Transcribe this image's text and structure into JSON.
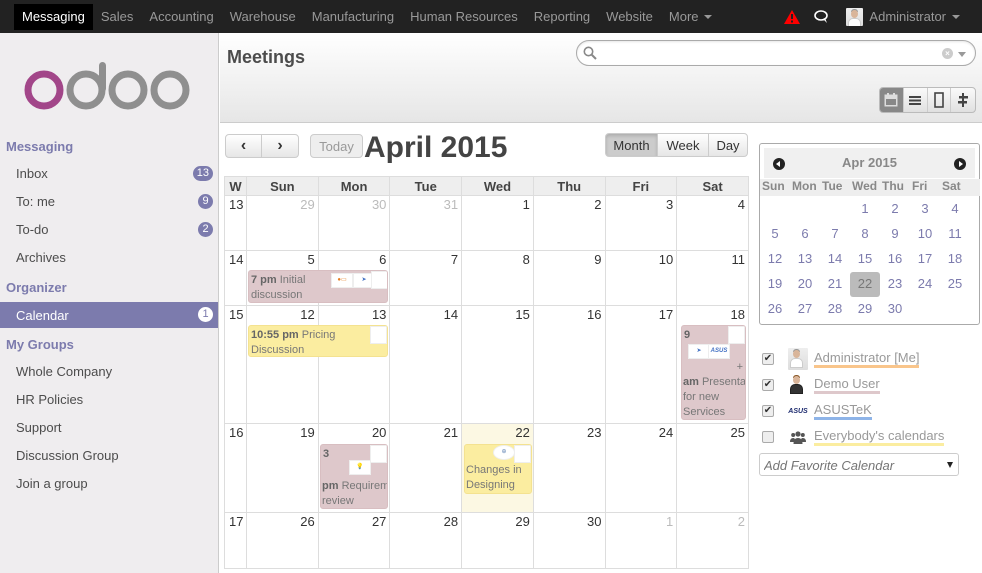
{
  "topbar": {
    "apps": [
      "Messaging",
      "Sales",
      "Accounting",
      "Warehouse",
      "Manufacturing",
      "Human Resources",
      "Reporting",
      "Website",
      "More"
    ],
    "active_app": "Messaging",
    "user_name": "Administrator",
    "icons": [
      "warning-icon",
      "chat-icon"
    ],
    "warning_color": "#ff0000"
  },
  "sidebar": {
    "logo_text": "odoo",
    "sections": [
      {
        "title": "Messaging",
        "items": [
          {
            "label": "Inbox",
            "badge": "13"
          },
          {
            "label": "To: me",
            "badge": "9"
          },
          {
            "label": "To-do",
            "badge": "2"
          },
          {
            "label": "Archives",
            "badge": null
          }
        ]
      },
      {
        "title": "Organizer",
        "items": [
          {
            "label": "Calendar",
            "badge": "1",
            "active": true
          }
        ]
      },
      {
        "title": "My Groups",
        "items": [
          {
            "label": "Whole Company"
          },
          {
            "label": "HR Policies"
          },
          {
            "label": "Support"
          },
          {
            "label": "Discussion Group"
          },
          {
            "label": "Join a group"
          }
        ]
      }
    ],
    "accent_color": "#7c7bad"
  },
  "header": {
    "title": "Meetings",
    "search_placeholder": "",
    "views": [
      "calendar-view",
      "list-view",
      "form-view",
      "gantt-view"
    ],
    "active_view": "calendar-view"
  },
  "calendar": {
    "prev_label": "‹",
    "next_label": "›",
    "today_label": "Today",
    "title": "April 2015",
    "modes": [
      "Month",
      "Week",
      "Day"
    ],
    "active_mode": "Month",
    "headers": [
      "W",
      "Sun",
      "Mon",
      "Tue",
      "Wed",
      "Thu",
      "Fri",
      "Sat"
    ],
    "weeks": [
      {
        "w": "13",
        "days": [
          "29",
          "30",
          "31",
          "1",
          "2",
          "3",
          "4"
        ],
        "other": [
          0,
          1,
          2
        ]
      },
      {
        "w": "14",
        "days": [
          "5",
          "6",
          "7",
          "8",
          "9",
          "10",
          "11"
        ],
        "other": []
      },
      {
        "w": "15",
        "days": [
          "12",
          "13",
          "14",
          "15",
          "16",
          "17",
          "18"
        ],
        "other": []
      },
      {
        "w": "16",
        "days": [
          "19",
          "20",
          "21",
          "22",
          "23",
          "24",
          "25"
        ],
        "other": []
      },
      {
        "w": "17",
        "days": [
          "26",
          "27",
          "28",
          "29",
          "30",
          "1",
          "2"
        ],
        "other": [
          5,
          6
        ]
      }
    ],
    "today": "22",
    "events": [
      {
        "time": "7 pm",
        "title": "Initial discussion",
        "days": "5-6",
        "color": "pink"
      },
      {
        "time": "10:55 pm",
        "title": "Pricing Discussion",
        "days": "12-13",
        "color": "yellow"
      },
      {
        "time_a": "9",
        "time_b": "am",
        "title": "Presentation for new Services",
        "day": "18",
        "color": "pink",
        "more": "+"
      },
      {
        "time_a": "3",
        "time_b": "pm",
        "title": "Requirements review",
        "day": "20",
        "color": "pink"
      },
      {
        "time": "",
        "title": "Changes in Designing",
        "day": "22",
        "color": "yellow"
      }
    ]
  },
  "mini_calendar": {
    "title": "Apr 2015",
    "dow": [
      "Sun",
      "Mon",
      "Tue",
      "Wed",
      "Thu",
      "Fri",
      "Sat"
    ],
    "rows": [
      [
        "",
        "",
        "",
        "1",
        "2",
        "3",
        "4"
      ],
      [
        "5",
        "6",
        "7",
        "8",
        "9",
        "10",
        "11"
      ],
      [
        "12",
        "13",
        "14",
        "15",
        "16",
        "17",
        "18"
      ],
      [
        "19",
        "20",
        "21",
        "22",
        "23",
        "24",
        "25"
      ],
      [
        "26",
        "27",
        "28",
        "29",
        "30",
        "",
        ""
      ]
    ],
    "selected": "22"
  },
  "filters": [
    {
      "label": "Administrator [Me]",
      "checked": true,
      "color": "#f9c58b"
    },
    {
      "label": "Demo User",
      "checked": true,
      "color": "#dec8cb"
    },
    {
      "label": "ASUSTeK",
      "checked": true,
      "color": "#8eb4e8"
    },
    {
      "label": "Everybody's calendars",
      "checked": false,
      "color": "#fbeda0"
    }
  ],
  "favorite_placeholder": "Add Favorite Calendar"
}
